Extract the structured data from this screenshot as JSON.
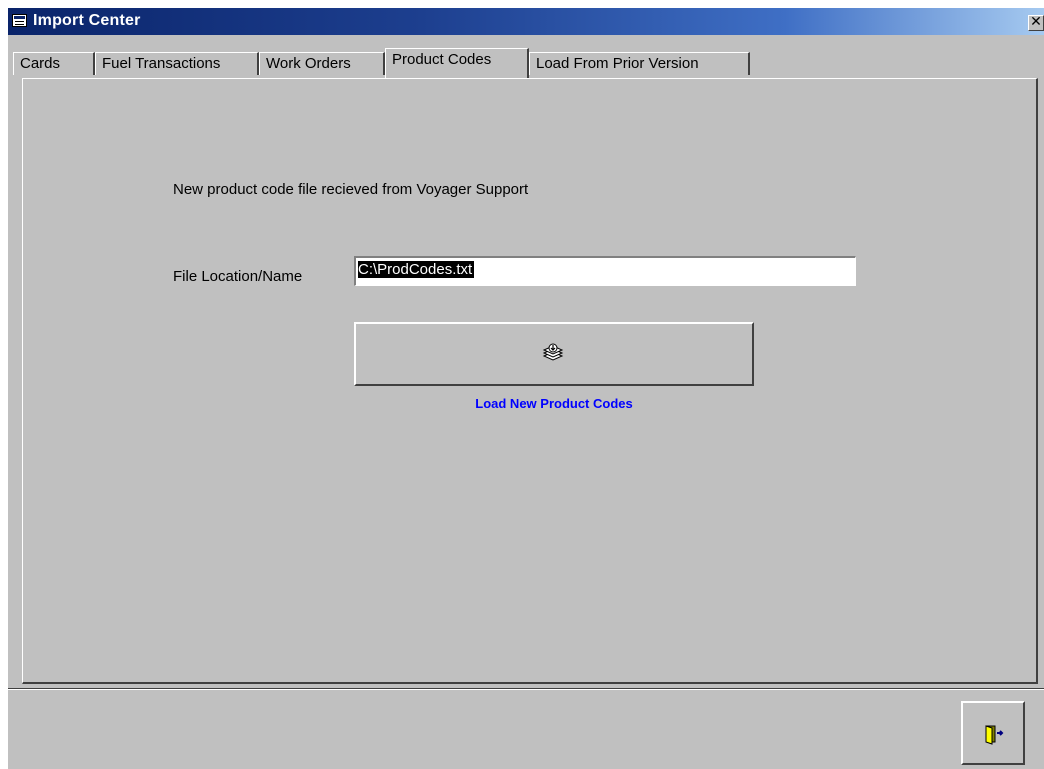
{
  "window": {
    "title": "Import Center",
    "close_glyph": "✕"
  },
  "tabs": [
    {
      "label": "Cards"
    },
    {
      "label": "Fuel Transactions"
    },
    {
      "label": "Work Orders"
    },
    {
      "label": "Product Codes",
      "active": true
    },
    {
      "label": "Load From Prior Version"
    }
  ],
  "panel": {
    "description": "New product code file recieved from Voyager Support",
    "file_label": "File Location/Name",
    "file_value": "C:\\ProdCodes.txt",
    "load_button_icon": "stack-download-icon",
    "load_caption": "Load New Product Codes"
  },
  "footer": {
    "exit_icon": "exit-door-icon"
  },
  "colors": {
    "title_start": "#0a246a",
    "title_end": "#a6caf0",
    "face": "#c0c0c0",
    "caption": "#0000ff"
  }
}
